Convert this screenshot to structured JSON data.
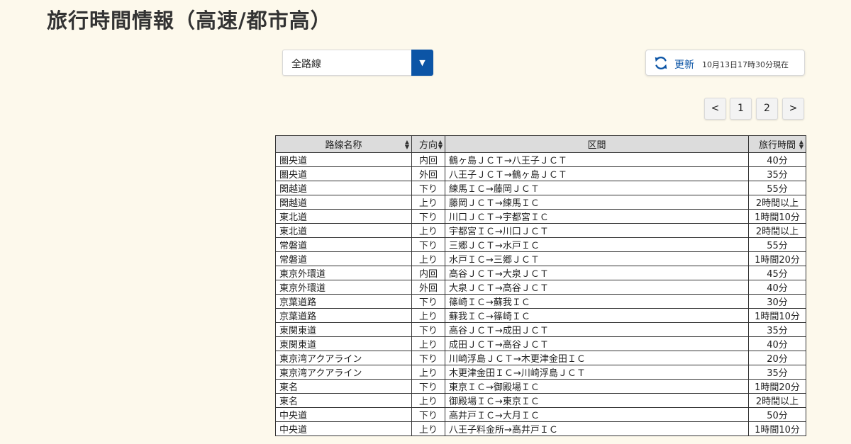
{
  "page": {
    "title": "旅行時間情報（高速/都市高）"
  },
  "route_select": {
    "value": "全路線",
    "arrow": "▼"
  },
  "refresh": {
    "label": "更新",
    "timestamp": "10月13日17時30分現在"
  },
  "pager": {
    "prev": "<",
    "pages": [
      "1",
      "2"
    ],
    "next": ">"
  },
  "table": {
    "headers": [
      "路線名称",
      "方向",
      "区間",
      "旅行時間"
    ],
    "rows": [
      [
        "圏央道",
        "内回",
        "鶴ヶ島ＪＣＴ→八王子ＪＣＴ",
        "40分"
      ],
      [
        "圏央道",
        "外回",
        "八王子ＪＣＴ→鶴ヶ島ＪＣＴ",
        "35分"
      ],
      [
        "関越道",
        "下り",
        "練馬ＩＣ→藤岡ＪＣＴ",
        "55分"
      ],
      [
        "関越道",
        "上り",
        "藤岡ＪＣＴ→練馬ＩＣ",
        "2時間以上"
      ],
      [
        "東北道",
        "下り",
        "川口ＪＣＴ→宇都宮ＩＣ",
        "1時間10分"
      ],
      [
        "東北道",
        "上り",
        "宇都宮ＩＣ→川口ＪＣＴ",
        "2時間以上"
      ],
      [
        "常磐道",
        "下り",
        "三郷ＪＣＴ→水戸ＩＣ",
        "55分"
      ],
      [
        "常磐道",
        "上り",
        "水戸ＩＣ→三郷ＪＣＴ",
        "1時間20分"
      ],
      [
        "東京外環道",
        "内回",
        "高谷ＪＣＴ→大泉ＪＣＴ",
        "45分"
      ],
      [
        "東京外環道",
        "外回",
        "大泉ＪＣＴ→高谷ＪＣＴ",
        "40分"
      ],
      [
        "京葉道路",
        "下り",
        "篠崎ＩＣ→蘇我ＩＣ",
        "30分"
      ],
      [
        "京葉道路",
        "上り",
        "蘇我ＩＣ→篠崎ＩＣ",
        "1時間10分"
      ],
      [
        "東関東道",
        "下り",
        "高谷ＪＣＴ→成田ＪＣＴ",
        "35分"
      ],
      [
        "東関東道",
        "上り",
        "成田ＪＣＴ→高谷ＪＣＴ",
        "40分"
      ],
      [
        "東京湾アクアライン",
        "下り",
        "川崎浮島ＪＣＴ→木更津金田ＩＣ",
        "20分"
      ],
      [
        "東京湾アクアライン",
        "上り",
        "木更津金田ＩＣ→川崎浮島ＪＣＴ",
        "35分"
      ],
      [
        "東名",
        "下り",
        "東京ＩＣ→御殿場ＩＣ",
        "1時間20分"
      ],
      [
        "東名",
        "上り",
        "御殿場ＩＣ→東京ＩＣ",
        "2時間以上"
      ],
      [
        "中央道",
        "下り",
        "高井戸ＩＣ→大月ＩＣ",
        "50分"
      ],
      [
        "中央道",
        "上り",
        "八王子料金所→高井戸ＩＣ",
        "1時間10分"
      ]
    ]
  },
  "colors": {
    "background": "#fdf9ec",
    "accent": "#0c55a6",
    "header_bg": "#dcdcdc"
  },
  "icons": {
    "refresh": "refresh-icon",
    "sort": "sort-icon",
    "dropdown": "chevron-down-icon"
  }
}
